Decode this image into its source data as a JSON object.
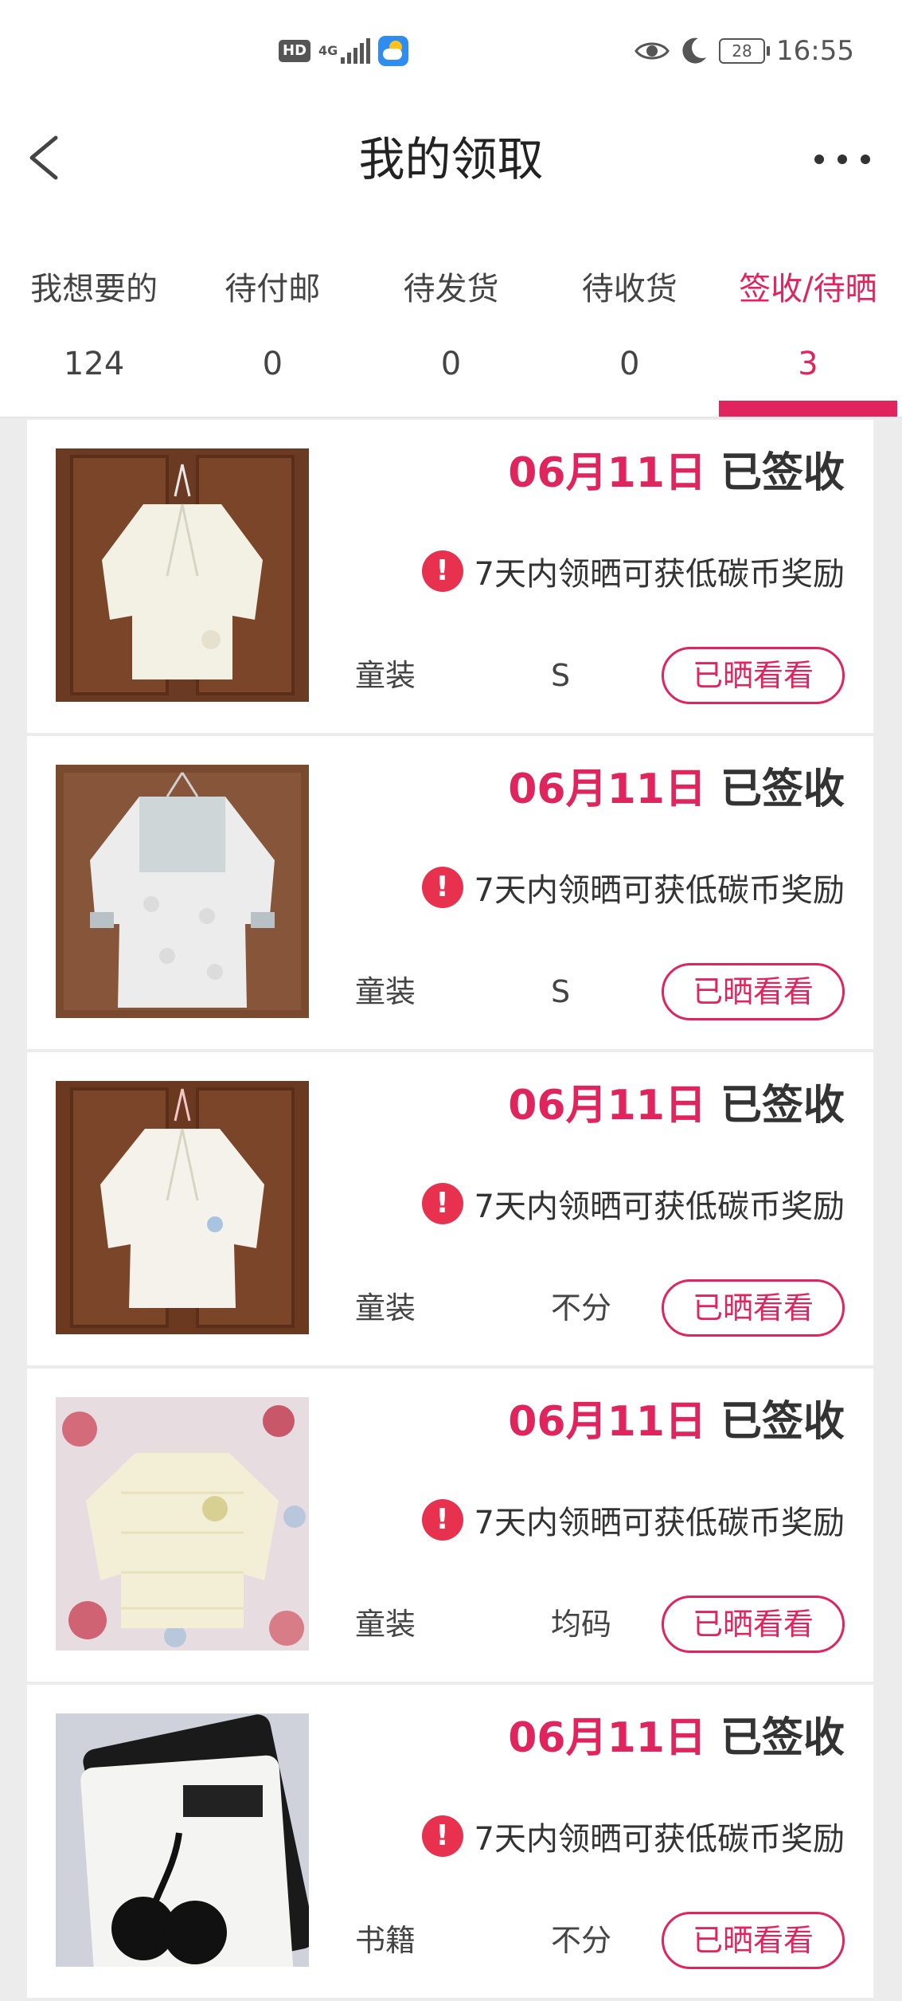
{
  "status_bar": {
    "network": "4G",
    "hd_label": "HD",
    "battery": "28",
    "time": "16:55"
  },
  "header": {
    "title": "我的领取"
  },
  "tabs": [
    {
      "label": "我想要的",
      "count": "124",
      "active": false
    },
    {
      "label": "待付邮",
      "count": "0",
      "active": false
    },
    {
      "label": "待发货",
      "count": "0",
      "active": false
    },
    {
      "label": "待收货",
      "count": "0",
      "active": false
    },
    {
      "label": "签收/待晒",
      "count": "3",
      "active": true
    }
  ],
  "colors": {
    "accent": "#e0245e",
    "background": "#ececec",
    "alert": "#e8304f"
  },
  "items": [
    {
      "date": "06月11日",
      "status": "已签收",
      "alert_icon": "!",
      "reward": "7天内领晒可获低碳币奖励",
      "category": "童装",
      "size": "S",
      "button": "已晒看看",
      "image": "white-baby-jacket"
    },
    {
      "date": "06月11日",
      "status": "已签收",
      "alert_icon": "!",
      "reward": "7天内领晒可获低碳币奖励",
      "category": "童装",
      "size": "S",
      "button": "已晒看看",
      "image": "grey-baby-romper"
    },
    {
      "date": "06月11日",
      "status": "已签收",
      "alert_icon": "!",
      "reward": "7天内领晒可获低碳币奖励",
      "category": "童装",
      "size": "不分",
      "button": "已晒看看",
      "image": "white-baby-shirt"
    },
    {
      "date": "06月11日",
      "status": "已签收",
      "alert_icon": "!",
      "reward": "7天内领晒可获低碳币奖励",
      "category": "童装",
      "size": "均码",
      "button": "已晒看看",
      "image": "cream-striped-top"
    },
    {
      "date": "06月11日",
      "status": "已签收",
      "alert_icon": "!",
      "reward": "7天内领晒可获低碳币奖励",
      "category": "书籍",
      "size": "不分",
      "button": "已晒看看",
      "image": "black-white-flash-cards"
    }
  ]
}
